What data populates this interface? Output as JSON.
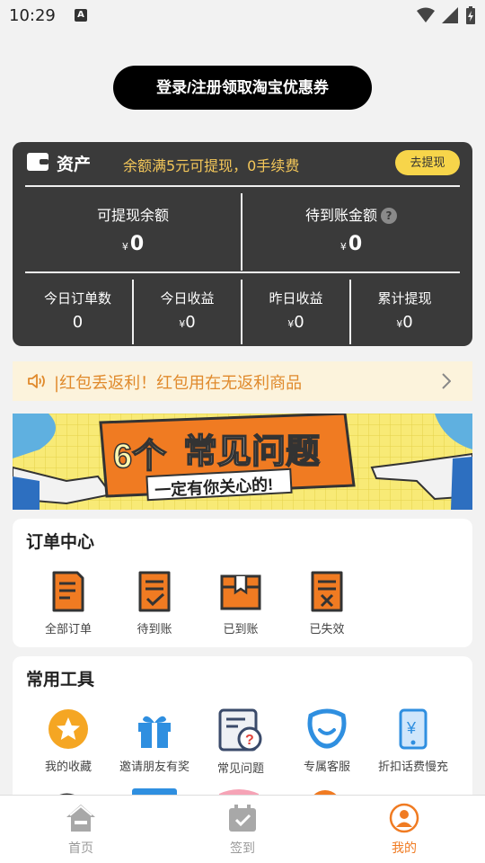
{
  "status_bar": {
    "time": "10:29",
    "notif_icon": "A"
  },
  "login_button": "登录/注册领取淘宝优惠券",
  "assets": {
    "title": "资产",
    "tip": "余额满5元可提现，0手续费",
    "withdraw_button": "去提现",
    "withdrawable_label": "可提现余额",
    "withdrawable_value": "0",
    "pending_label": "待到账金额",
    "pending_value": "0",
    "currency": "¥",
    "stats": [
      {
        "label": "今日订单数",
        "value": "0"
      },
      {
        "label": "今日收益",
        "value": "0"
      },
      {
        "label": "昨日收益",
        "value": "0"
      },
      {
        "label": "累计提现",
        "value": "0"
      }
    ]
  },
  "notice": {
    "text": "|红包丢返利！红包用在无返利商品"
  },
  "banner": {
    "headline_num": "6个",
    "headline": "常见问题",
    "subline": "一定有你关心的!"
  },
  "orders": {
    "title": "订单中心",
    "items": [
      {
        "label": "全部订单",
        "icon": "all-orders-icon"
      },
      {
        "label": "待到账",
        "icon": "pending-icon"
      },
      {
        "label": "已到账",
        "icon": "received-icon"
      },
      {
        "label": "已失效",
        "icon": "expired-icon"
      }
    ]
  },
  "tools": {
    "title": "常用工具",
    "items": [
      {
        "label": "我的收藏",
        "icon": "star-icon"
      },
      {
        "label": "邀请朋友有奖",
        "icon": "gift-icon"
      },
      {
        "label": "常见问题",
        "icon": "faq-icon"
      },
      {
        "label": "专属客服",
        "icon": "service-icon"
      },
      {
        "label": "折扣话费慢充",
        "icon": "phone-icon"
      }
    ]
  },
  "tabbar": {
    "items": [
      {
        "label": "首页",
        "icon": "home-icon"
      },
      {
        "label": "签到",
        "icon": "checkin-icon"
      },
      {
        "label": "我的",
        "icon": "profile-icon"
      }
    ]
  },
  "colors": {
    "accent": "#f07b22",
    "dark_card": "#3a3a3a",
    "yellow": "#f7d54a",
    "notice_text": "#e08a2c"
  }
}
